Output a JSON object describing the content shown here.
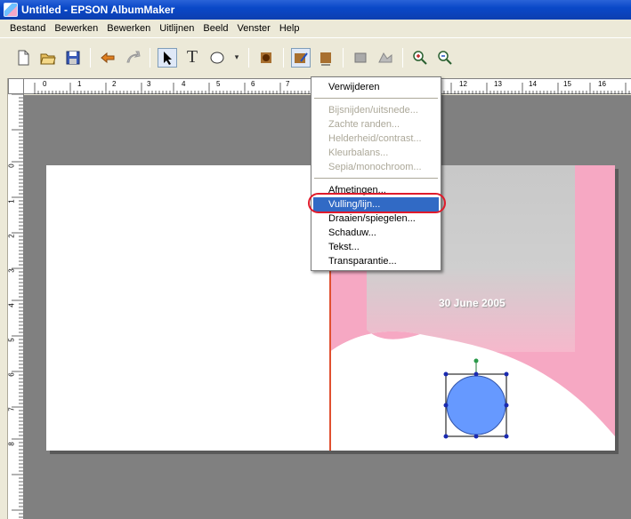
{
  "window": {
    "title": "Untitled - EPSON AlbumMaker"
  },
  "menubar": [
    "Bestand",
    "Bewerken",
    "Bewerken",
    "Uitlijnen",
    "Beeld",
    "Venster",
    "Help"
  ],
  "toolbar": {
    "buttons": [
      "new-document-icon",
      "open-folder-icon",
      "save-icon",
      "undo-icon",
      "redo-icon",
      "select-arrow-icon",
      "text-tool-icon",
      "ellipse-tool-icon",
      "tool-dropdown-icon",
      "photo-effect-icon",
      "photo-edit-icon",
      "photo-edit-menu-icon",
      "photo-gray-icon",
      "photo-gray2-icon",
      "zoom-in-icon",
      "zoom-out-icon"
    ]
  },
  "ruler": {
    "top_labels": [
      "0",
      "1",
      "2",
      "3",
      "4",
      "5",
      "6",
      "7",
      "12",
      "13",
      "14",
      "15",
      "16"
    ],
    "left_labels": [
      "0",
      "1",
      "2",
      "3",
      "4",
      "5",
      "6",
      "7",
      "8"
    ]
  },
  "canvas": {
    "date_text": "30 June 2005",
    "colors": {
      "workspace": "#808080",
      "pink": "#f6a8c3",
      "gray_panel": "#c8c8c8",
      "circle": "#6699ff",
      "fold_line": "#e05030"
    }
  },
  "context_menu": {
    "items": [
      {
        "label": "Verwijderen",
        "state": "enabled"
      },
      {
        "label": "Bijsnijden/uitsnede...",
        "state": "disabled"
      },
      {
        "label": "Zachte randen...",
        "state": "disabled"
      },
      {
        "label": "Helderheid/contrast...",
        "state": "disabled"
      },
      {
        "label": "Kleurbalans...",
        "state": "disabled"
      },
      {
        "label": "Sepia/monochroom...",
        "state": "disabled"
      },
      {
        "label": "Afmetingen...",
        "state": "enabled"
      },
      {
        "label": "Vulling/lijn...",
        "state": "selected"
      },
      {
        "label": "Draaien/spiegelen...",
        "state": "enabled"
      },
      {
        "label": "Schaduw...",
        "state": "enabled"
      },
      {
        "label": "Tekst...",
        "state": "enabled"
      },
      {
        "label": "Transparantie...",
        "state": "enabled"
      }
    ]
  }
}
